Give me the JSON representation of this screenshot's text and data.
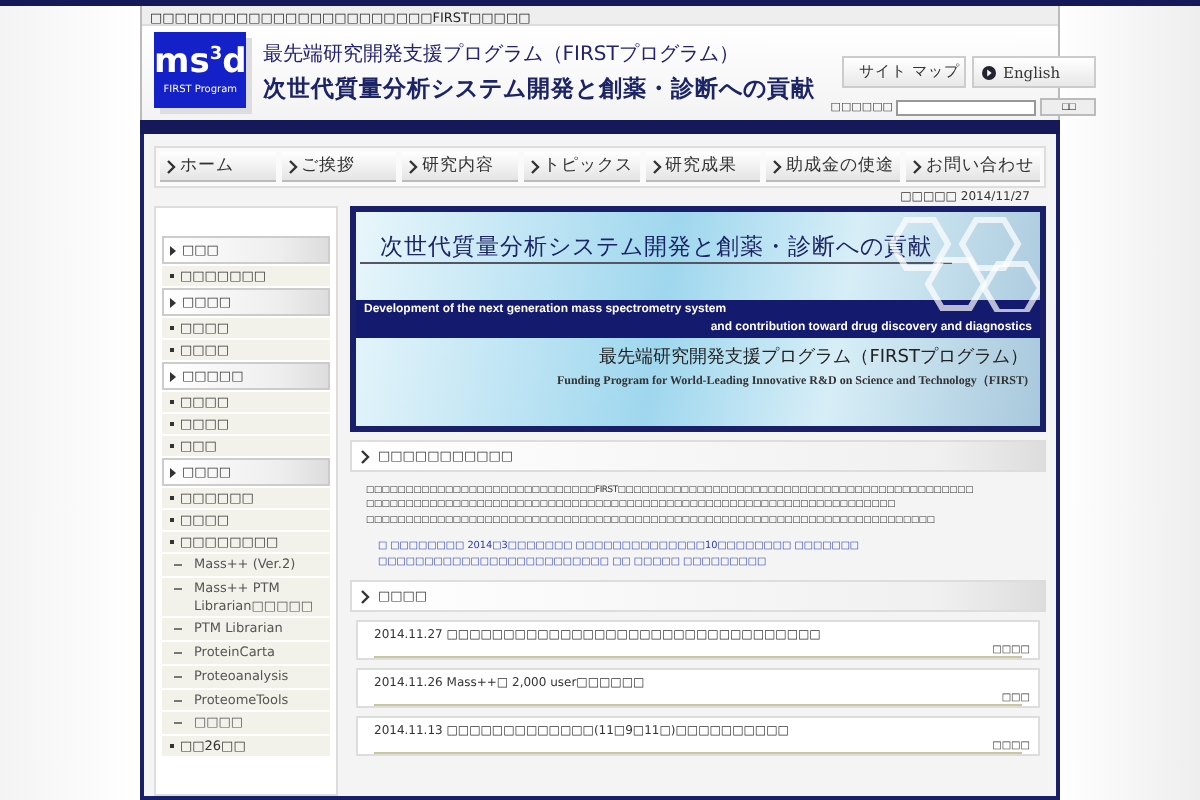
{
  "top_notice": "□□□□□□□□□□□□□□□□□□□□□□□FIRST□□□□□",
  "header": {
    "logo": {
      "main": "ms",
      "sup": "3",
      "end": "d",
      "sub": "FIRST Program"
    },
    "program": "最先端研究開発支援プログラム（FIRSTプログラム）",
    "title": "次世代質量分析システム開発と創薬・診断への貢献",
    "links": [
      {
        "label": "サイト マップ"
      },
      {
        "label": "English"
      }
    ],
    "search": {
      "label": "□□□□□□",
      "button": "□□"
    }
  },
  "nav": [
    {
      "label": "ホーム"
    },
    {
      "label": "ご挨拶"
    },
    {
      "label": "研究内容"
    },
    {
      "label": "トピックス"
    },
    {
      "label": "研究成果"
    },
    {
      "label": "助成金の使途"
    },
    {
      "label": "お問い合わせ"
    }
  ],
  "updated": {
    "label": "□□□□□",
    "value": "2014/11/27"
  },
  "sidebar": [
    {
      "label": "□□□",
      "children": [
        {
          "label": "□□□□□□□"
        }
      ]
    },
    {
      "label": "□□□□",
      "children": [
        {
          "label": "□□□□"
        },
        {
          "label": "□□□□"
        }
      ]
    },
    {
      "label": "□□□□□",
      "children": [
        {
          "label": "□□□□"
        },
        {
          "label": "□□□□"
        },
        {
          "label": "□□□"
        }
      ]
    },
    {
      "label": "□□□□",
      "children": [
        {
          "label": "□□□□□□"
        },
        {
          "label": "□□□□"
        },
        {
          "label": "□□□□□□□□",
          "children": [
            {
              "label": "Mass++ (Ver.2)"
            },
            {
              "label": "Mass++ PTM Librarian□□□□□"
            },
            {
              "label": "PTM Librarian"
            },
            {
              "label": "ProteinCarta"
            },
            {
              "label": "Proteoanalysis"
            },
            {
              "label": "ProteomeTools"
            },
            {
              "label": "□□□□"
            }
          ]
        },
        {
          "label": "□□26□□"
        }
      ]
    }
  ],
  "banner": {
    "title": "次世代質量分析システム開発と創薬・診断への貢献",
    "english_1": "Development of the next generation mass spectrometry system",
    "english_2": "and contribution toward drug discovery and diagnostics",
    "program": "最先端研究開発支援プログラム（FIRSTプログラム）",
    "program_en": "Funding Program for World-Leading Innovative R&D on Science and Technology（FIRST)"
  },
  "intro": {
    "heading": "□□□□□□□□□□□",
    "lines": [
      "□□□□□□□□□□□□□□□□□□□□□□□□□□□□□FIRST□□□□□□□□□□□□□□□□□□□□□□□□□□□□□□□□□□□□□□□□□□□□□",
      "□□□□□□□□□□□□□□□□□□□□□□□□□□□□□□□□□□□□□□□□□□□□□□□□□□□□□□□□□□□□□□□□□□□",
      "□□□□□□□□□□□□□□□□□□□□□□□□□□□□□□□□□□□□□□□□□□□□□□□□□□□□□□□□□□□□□□□□□□□□□□□□"
    ],
    "link": "□ □□□□□□□□ 2014□3□□□□□□□ □□□□□□□□□□□□□□10□□□□□□□□ □□□□□□□ □□□□□□□□□□□□□□□□□□□□□□□□□ □□ □□□□□ □□□□□□□□□"
  },
  "news": {
    "heading": "□□□□",
    "items": [
      {
        "text": "2014.11.27 □□□□□□□□□□□□□□□□□□□□□□□□□□□□□□□□□",
        "tag": "□□□□"
      },
      {
        "text": "2014.11.26 Mass++□ 2,000 user□□□□□□",
        "tag": "□□□"
      },
      {
        "text": "2014.11.13 □□□□□□□□□□□□□(11□9□11□)□□□□□□□□□□",
        "tag": "□□□□"
      }
    ]
  }
}
